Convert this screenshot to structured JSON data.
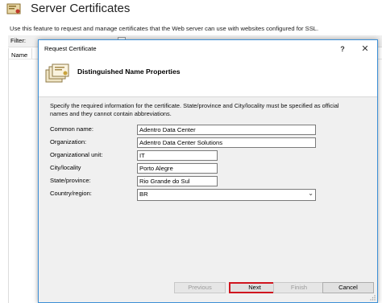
{
  "background": {
    "title": "Server Certificates",
    "description": "Use this feature to request and manage certificates that the Web server can use with websites configured for SSL.",
    "filter_label": "Filter:",
    "column_name": "Name"
  },
  "dialog": {
    "title": "Request Certificate",
    "help_glyph": "?",
    "close_glyph": "✕",
    "header_title": "Distinguished Name Properties",
    "instructions": "Specify the required information for the certificate. State/province and City/locality must be specified as official names and they cannot contain abbreviations.",
    "fields": {
      "common_name": {
        "label": "Common name:",
        "value": "Adentro Data Center"
      },
      "organization": {
        "label": "Organization:",
        "value": "Adentro Data Center Solutions"
      },
      "organizational_unit": {
        "label": "Organizational unit:",
        "value": "IT"
      },
      "city": {
        "label": "City/locality",
        "value": "Porto Alegre"
      },
      "state": {
        "label": "State/province:",
        "value": "Rio Grande do Sul"
      },
      "country": {
        "label": "Country/region:",
        "value": "BR"
      }
    },
    "buttons": {
      "previous": "Previous",
      "next": "Next",
      "finish": "Finish",
      "cancel": "Cancel"
    }
  },
  "colors": {
    "dialog_border": "#3c8fd6",
    "next_highlight": "#d0151f",
    "body_background": "#f0f0f0"
  }
}
